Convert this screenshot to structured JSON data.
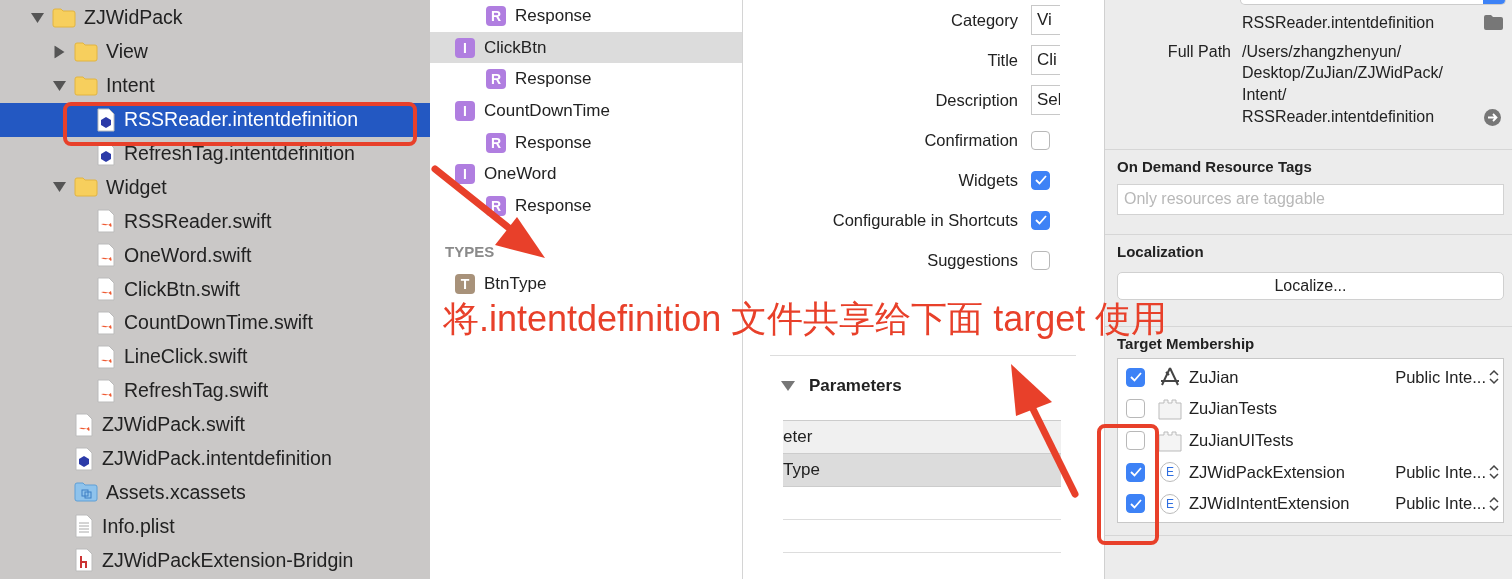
{
  "navigator": {
    "items": [
      {
        "name": "ZJWidPack",
        "kind": "folder",
        "expanded": true,
        "selected": false,
        "children": [
          {
            "name": "View",
            "kind": "folder",
            "expanded": false,
            "selected": false
          },
          {
            "name": "Intent",
            "kind": "folder",
            "expanded": true,
            "selected": false,
            "children": [
              {
                "name": "RSSReader.intentdefinition",
                "kind": "intent",
                "selected": true
              },
              {
                "name": "RefreshTag.intentdefinition",
                "kind": "intent",
                "selected": false
              }
            ]
          },
          {
            "name": "Widget",
            "kind": "folder",
            "expanded": true,
            "selected": false,
            "children": [
              {
                "name": "RSSReader.swift",
                "kind": "swift",
                "selected": false
              },
              {
                "name": "OneWord.swift",
                "kind": "swift",
                "selected": false
              },
              {
                "name": "ClickBtn.swift",
                "kind": "swift",
                "selected": false
              },
              {
                "name": "CountDownTime.swift",
                "kind": "swift",
                "selected": false
              },
              {
                "name": "LineClick.swift",
                "kind": "swift",
                "selected": false
              },
              {
                "name": "RefreshTag.swift",
                "kind": "swift",
                "selected": false
              }
            ]
          },
          {
            "name": "ZJWidPack.swift",
            "kind": "swift",
            "selected": false
          },
          {
            "name": "ZJWidPack.intentdefinition",
            "kind": "intent",
            "selected": false
          },
          {
            "name": "Assets.xcassets",
            "kind": "assets",
            "selected": false
          },
          {
            "name": "Info.plist",
            "kind": "plist",
            "selected": false
          },
          {
            "name": "ZJWidPackExtension-Bridgin",
            "kind": "header",
            "selected": false
          }
        ]
      }
    ]
  },
  "intents": {
    "items": [
      {
        "name": "Response",
        "kind": "response",
        "badge": "R",
        "selected": false
      },
      {
        "name": "ClickBtn",
        "kind": "intent",
        "badge": "I",
        "selected": true,
        "children": [
          {
            "name": "Response",
            "kind": "response",
            "badge": "R",
            "selected": false
          }
        ]
      },
      {
        "name": "CountDownTime",
        "kind": "intent",
        "badge": "I",
        "selected": false,
        "children": [
          {
            "name": "Response",
            "kind": "response",
            "badge": "R",
            "selected": false
          }
        ]
      },
      {
        "name": "OneWord",
        "kind": "intent",
        "badge": "I",
        "selected": false,
        "children": [
          {
            "name": "Response",
            "kind": "response",
            "badge": "R",
            "selected": false
          }
        ]
      }
    ],
    "types_header": "TYPES",
    "types": [
      {
        "name": "BtnType",
        "kind": "type",
        "badge": "T",
        "selected": false
      }
    ]
  },
  "editor": {
    "rows": [
      {
        "label": "Category",
        "kind": "field",
        "value": "Vi"
      },
      {
        "label": "Title",
        "kind": "field",
        "value": "Cli"
      },
      {
        "label": "Description",
        "kind": "field",
        "value": "Sel"
      },
      {
        "label": "Confirmation",
        "kind": "checkbox",
        "checked": false
      },
      {
        "label": "Widgets",
        "kind": "checkbox",
        "checked": true
      },
      {
        "label": "Configurable in Shortcuts",
        "kind": "checkbox",
        "checked": true
      },
      {
        "label": "Suggestions",
        "kind": "checkbox",
        "checked": false
      }
    ],
    "parameters": {
      "title": "Parameters",
      "expanded": true,
      "rows": [
        {
          "text": "eter",
          "selected": false
        },
        {
          "text": "Type",
          "selected": true
        }
      ]
    }
  },
  "inspector": {
    "file_name": "RSSReader.intentdefinition",
    "full_path": {
      "label": "Full Path",
      "lines": [
        "/Users/zhangzhenyun/",
        "Desktop/ZuJian/ZJWidPack/",
        "Intent/",
        "RSSReader.intentdefinition"
      ]
    },
    "on_demand": {
      "title": "On Demand Resource Tags",
      "placeholder": "Only resources are taggable"
    },
    "localization": {
      "title": "Localization",
      "button": "Localize..."
    },
    "target_membership": {
      "title": "Target Membership",
      "targets": [
        {
          "name": "ZuJian",
          "kind": "app",
          "checked": true,
          "access": "Public Inte..."
        },
        {
          "name": "ZuJianTests",
          "kind": "bundle",
          "checked": false
        },
        {
          "name": "ZuJianUITests",
          "kind": "bundle",
          "checked": false
        },
        {
          "name": "ZJWidPackExtension",
          "kind": "extension",
          "badge": "E",
          "checked": true,
          "access": "Public Inte..."
        },
        {
          "name": "ZJWidIntentExtension",
          "kind": "extension",
          "badge": "E",
          "checked": true,
          "access": "Public Inte..."
        }
      ]
    }
  },
  "annotation": {
    "text": "将.intentdefinition 文件共享给下面 target 使用"
  }
}
